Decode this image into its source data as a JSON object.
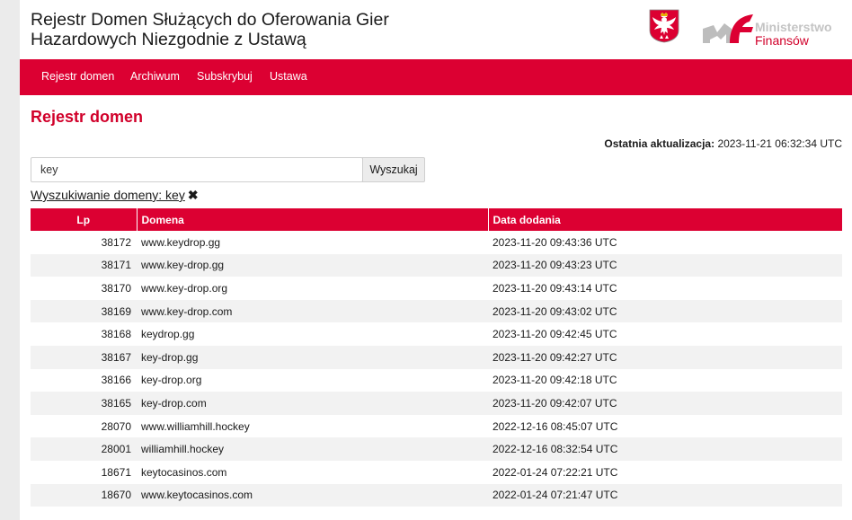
{
  "header": {
    "title": "Rejestr Domen Służących do Oferowania Gier Hazardowych Niezgodnie z Ustawą",
    "logo_line1": "Ministerstwo",
    "logo_line2": "Finansów"
  },
  "nav": [
    {
      "label": "Rejestr domen"
    },
    {
      "label": "Archiwum"
    },
    {
      "label": "Subskrybuj"
    },
    {
      "label": "Ustawa"
    }
  ],
  "main": {
    "heading": "Rejestr domen",
    "update_label": "Ostatnia aktualizacja:",
    "update_value": "2023-11-21 06:32:34 UTC",
    "search_value": "key",
    "search_button": "Wyszukaj",
    "filter_label": "Wyszukiwanie domeny: key",
    "filter_clear": "✖"
  },
  "table": {
    "headers": [
      "Lp",
      "Domena",
      "Data dodania"
    ],
    "rows": [
      [
        "38172",
        "www.keydrop.gg",
        "2023-11-20 09:43:36 UTC"
      ],
      [
        "38171",
        "www.key-drop.gg",
        "2023-11-20 09:43:23 UTC"
      ],
      [
        "38170",
        "www.key-drop.org",
        "2023-11-20 09:43:14 UTC"
      ],
      [
        "38169",
        "www.key-drop.com",
        "2023-11-20 09:43:02 UTC"
      ],
      [
        "38168",
        "keydrop.gg",
        "2023-11-20 09:42:45 UTC"
      ],
      [
        "38167",
        "key-drop.gg",
        "2023-11-20 09:42:27 UTC"
      ],
      [
        "38166",
        "key-drop.org",
        "2023-11-20 09:42:18 UTC"
      ],
      [
        "38165",
        "key-drop.com",
        "2023-11-20 09:42:07 UTC"
      ],
      [
        "28070",
        "www.williamhill.hockey",
        "2022-12-16 08:45:07 UTC"
      ],
      [
        "28001",
        "williamhill.hockey",
        "2022-12-16 08:32:54 UTC"
      ],
      [
        "18671",
        "keytocasinos.com",
        "2022-01-24 07:22:21 UTC"
      ],
      [
        "18670",
        "www.keytocasinos.com",
        "2022-01-24 07:21:47 UTC"
      ]
    ]
  },
  "colors": {
    "brand_red": "#dc0032",
    "heading_red": "#d1002a",
    "row_stripe": "#f2f2f2"
  }
}
